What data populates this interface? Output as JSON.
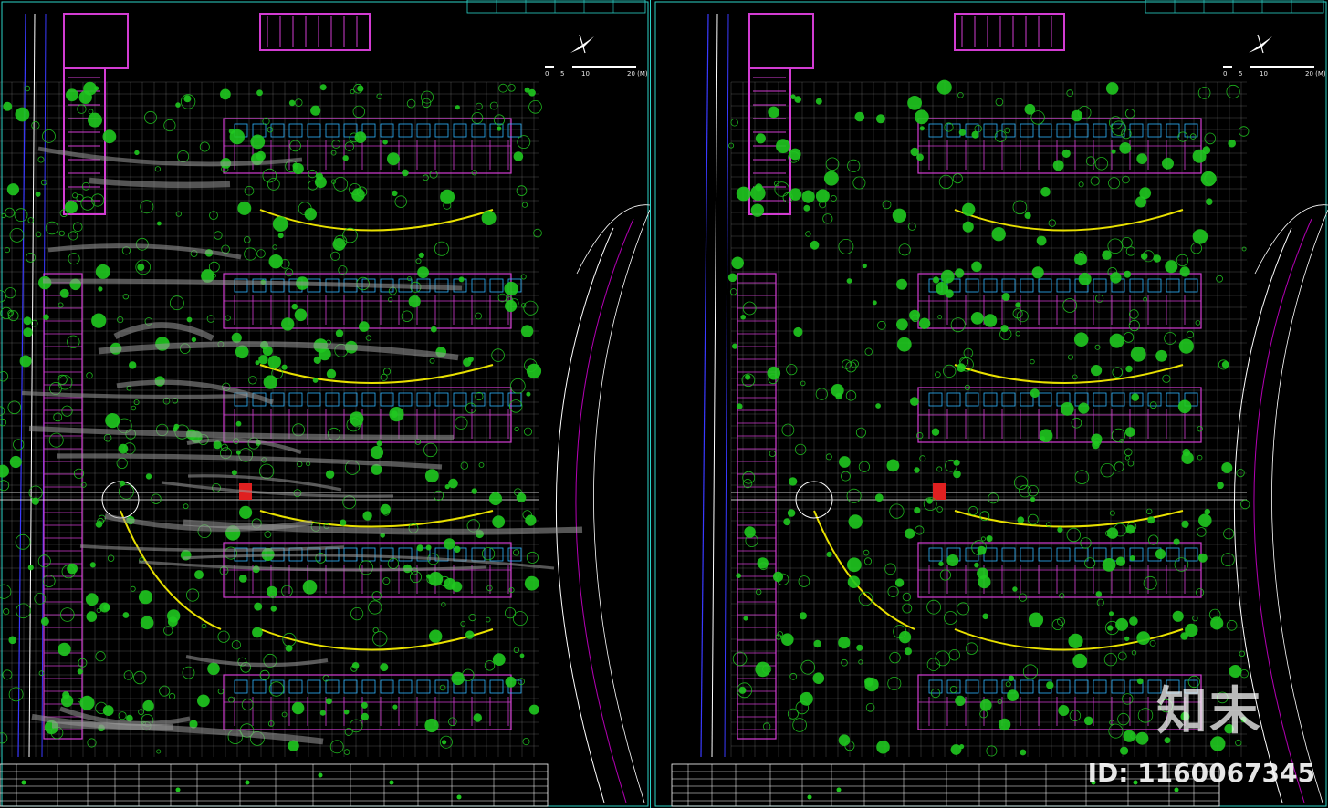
{
  "drawing": {
    "scale_bar": {
      "ticks": [
        "0",
        "5",
        "10",
        "20 (M)"
      ]
    },
    "colors": {
      "background": "#000000",
      "grid": "#c8c8c8",
      "building": "#d23cd2",
      "tree": "#20c820",
      "road_blue": "#3a3aff",
      "road_magenta": "#b400b4",
      "path_yellow": "#e8e000",
      "frame_cyan": "#2bd3c8",
      "accent_red": "#e02020"
    }
  },
  "watermark": {
    "logo_text": "知末",
    "id_text": "ID: 1160067345"
  },
  "icons": {
    "north_arrow": "north-arrow-icon"
  }
}
